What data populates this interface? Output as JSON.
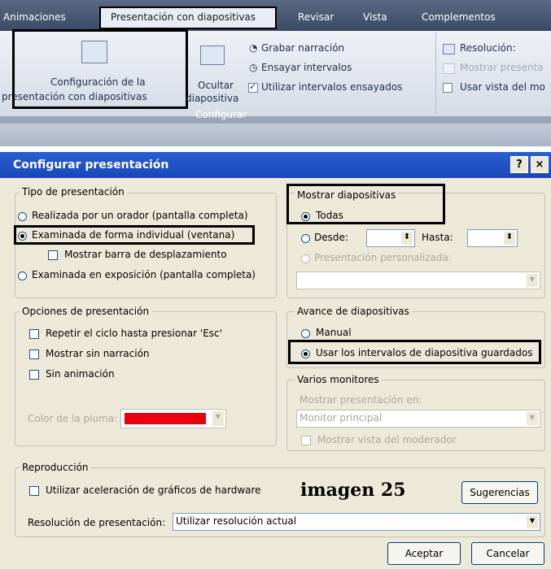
{
  "ribbon": {
    "tabs": [
      "Animaciones",
      "Revisar",
      "Vista",
      "Complementos"
    ],
    "active_tab": "Presentación con diapositivas",
    "config_label_line1": "Configuración de la",
    "config_label_line2": "presentación con diapositivas",
    "hide_label_line1": "Ocultar",
    "hide_label_line2": "diapositiva",
    "record_narration": "Grabar narración",
    "rehearse_timings": "Ensayar intervalos",
    "use_timings": "Utilizar intervalos ensayados",
    "group_label": "Configurar",
    "resolution": "Resolución:",
    "show_presentation": "Mostrar presenta",
    "use_presenter_view": "Usar vista del mo"
  },
  "dialog": {
    "title": "Configurar presentación",
    "help_button": "?",
    "close_button": "×",
    "show_type": {
      "legend": "Tipo de presentación",
      "opt1": "Realizada por un orador (pantalla completa)",
      "opt2": "Examinada de forma individual (ventana)",
      "scrollbar": "Mostrar barra de desplazamiento",
      "opt3": "Examinada en exposición (pantalla completa)"
    },
    "show_slides": {
      "legend": "Mostrar diapositivas",
      "all": "Todas",
      "from": "Desde:",
      "to": "Hasta:",
      "custom": "Presentación personalizada:"
    },
    "show_options": {
      "legend": "Opciones de presentación",
      "loop": "Repetir el ciclo hasta presionar 'Esc'",
      "no_narration": "Mostrar sin narración",
      "no_animation": "Sin animación",
      "pen_color": "Color de la pluma:"
    },
    "advance": {
      "legend": "Avance de diapositivas",
      "manual": "Manual",
      "timings": "Usar los intervalos de diapositiva guardados"
    },
    "monitors": {
      "legend": "Varios monitores",
      "display_on": "Mostrar presentación en:",
      "monitor_value": "Monitor principal",
      "presenter_view": "Mostrar vista del moderador"
    },
    "playback": {
      "legend": "Reproducción",
      "hw_accel": "Utilizar aceleración de gráficos de hardware",
      "tips_button": "Sugerencias",
      "resolution_label": "Resolución de presentación:",
      "resolution_value": "Utilizar resolución actual"
    },
    "ok_button": "Aceptar",
    "cancel_button": "Cancelar"
  },
  "overlay_label": "imagen 25",
  "colors": {
    "pen_color": "#e8000a",
    "title_bar": "#1a47b8",
    "dialog_bg": "#ece9d8"
  }
}
